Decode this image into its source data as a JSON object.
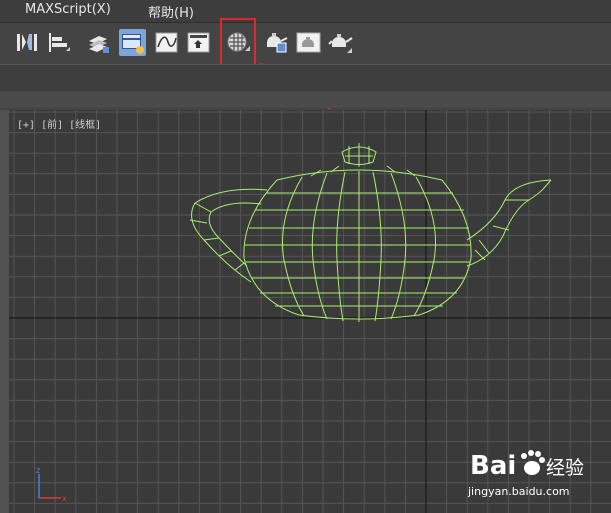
{
  "menubar": {
    "items": [
      {
        "label": "MAXScript(X)"
      },
      {
        "label": "帮助(H)"
      }
    ]
  },
  "viewport": {
    "label": "[+] [前] [线框]"
  },
  "watermark": {
    "brand": "Bai",
    "brand_suffix": "经验",
    "url": "jingyan.baidu.com"
  },
  "axis_gizmo": {
    "z": "z",
    "x": "x"
  },
  "colors": {
    "wireframe": "#a8f070",
    "highlight": "#e0282a"
  }
}
